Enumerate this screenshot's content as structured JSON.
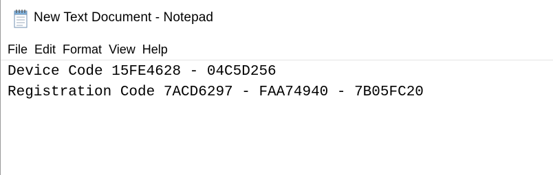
{
  "window": {
    "title": "New Text Document - Notepad",
    "icon": "notepad-icon"
  },
  "menu": {
    "items": [
      {
        "label": "File"
      },
      {
        "label": "Edit"
      },
      {
        "label": "Format"
      },
      {
        "label": "View"
      },
      {
        "label": "Help"
      }
    ]
  },
  "editor": {
    "lines": [
      "Device Code 15FE4628 - 04C5D256",
      "Registration Code 7ACD6297 - FAA74940 - 7B05FC20"
    ]
  }
}
